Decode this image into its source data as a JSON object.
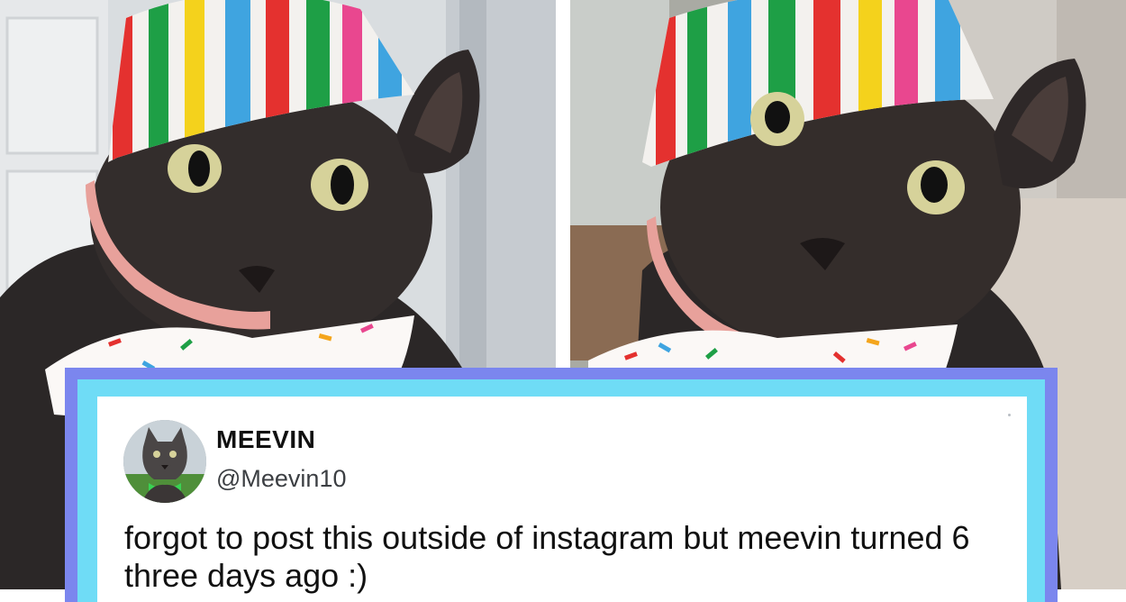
{
  "images": [
    {
      "subject": "black-cat-party-hat-left",
      "colors": {
        "hat_stripes": [
          "#e4312f",
          "#1e9f46",
          "#f4d21c",
          "#3fa4e0",
          "#e9478f"
        ],
        "fur": "#2b2727",
        "collar": "#e8a19b",
        "eyes": "#d6d29a"
      }
    },
    {
      "subject": "black-cat-party-hat-right",
      "colors": {
        "hat_stripes": [
          "#e4312f",
          "#1e9f46",
          "#f4d21c",
          "#3fa4e0",
          "#e9478f"
        ],
        "fur": "#2b2727",
        "collar": "#e8a19b",
        "eyes": "#d6d29a"
      }
    }
  ],
  "tweet": {
    "avatar_icon": "cat-avatar",
    "author_name": "MEEVIN",
    "author_handle": "@Meevin10",
    "text": "forgot to post this outside of instagram but meevin turned 6 three days ago :)",
    "frame_colors": {
      "outer": "#7b86ee",
      "inner": "#6fdcf6",
      "card": "#ffffff"
    }
  }
}
